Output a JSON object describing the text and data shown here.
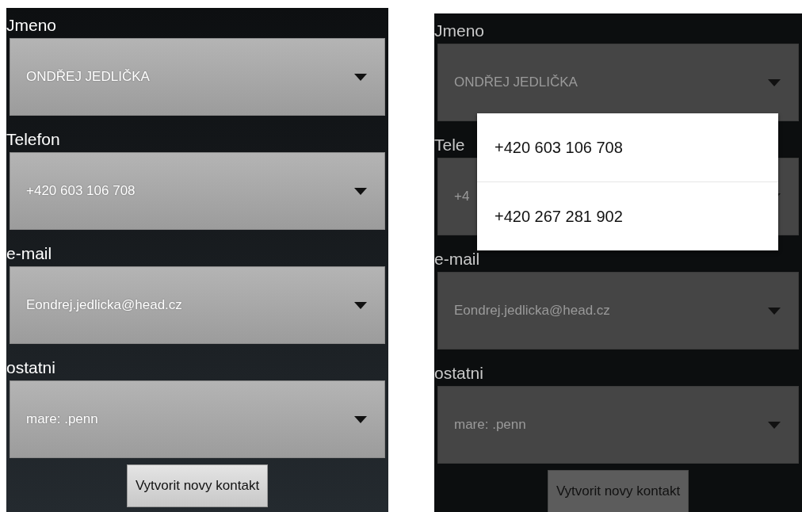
{
  "screens": [
    {
      "dimmed": false,
      "fields": [
        {
          "label": "Jmeno",
          "value": "ONDŘEJ JEDLIČKA"
        },
        {
          "label": "Telefon",
          "value": "+420 603 106 708"
        },
        {
          "label": "e-mail",
          "value": "Eondrej.jedlicka@head.cz"
        },
        {
          "label": "ostatni",
          "value": "mare: .penn"
        }
      ],
      "button": "Vytvorit novy kontakt"
    },
    {
      "dimmed": true,
      "fields": [
        {
          "label": "Jmeno",
          "value": "ONDŘEJ JEDLIČKA"
        },
        {
          "label": "Tele",
          "value": "+4"
        },
        {
          "label": "e-mail",
          "value": "Eondrej.jedlicka@head.cz"
        },
        {
          "label": "ostatni",
          "value": "mare: .penn"
        }
      ],
      "button": "Vytvorit novy kontakt",
      "popup": {
        "options": [
          "+420 603 106 708",
          "+420 267 281 902"
        ]
      }
    }
  ]
}
